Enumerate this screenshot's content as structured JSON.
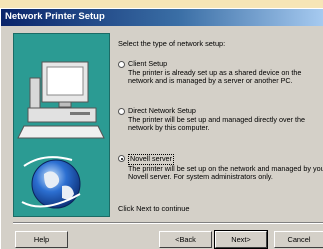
{
  "window": {
    "title": "Network Printer Setup"
  },
  "prompt": "Select the type of network setup:",
  "options": [
    {
      "label": "Client Setup",
      "description": "The printer is already set up as a shared device on the network and is managed by a server or another PC.",
      "selected": false
    },
    {
      "label": "Direct Network Setup",
      "description": "The printer will be set up and managed directly over the network by this computer.",
      "selected": false
    },
    {
      "label": "Novell server",
      "description": "The printer will be set up on the network and managed by your Novell server. For system administrators only.",
      "selected": true
    }
  ],
  "footer_text": "Click Next to continue",
  "buttons": {
    "help": "Help",
    "back": "<Back",
    "next": "Next>",
    "cancel": "Cancel"
  }
}
